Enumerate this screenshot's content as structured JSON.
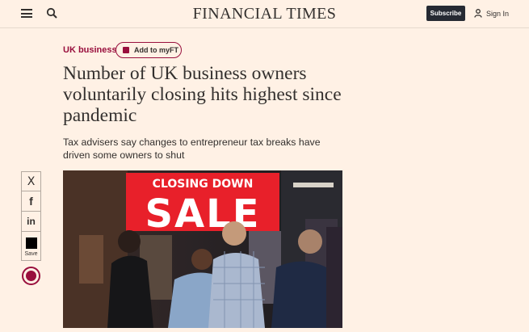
{
  "header": {
    "brand": "FINANCIAL TIMES",
    "subscribe_label": "Subscribe",
    "signin_label": "Sign In"
  },
  "article": {
    "topic": "UK business",
    "myft_label": "Add to myFT",
    "headline": "Number of UK business owners voluntarily closing hits highest since pandemic",
    "standfirst": "Tax advisers say changes to entrepreneur tax breaks have driven some owners to shut"
  },
  "share": {
    "save_label": "Save",
    "x_glyph": "X",
    "facebook_glyph": "f",
    "linkedin_glyph": "in"
  },
  "image": {
    "sign_top": "CLOSING DOWN",
    "sign_main": "SALE"
  },
  "colors": {
    "background": "#fff1e5",
    "claret": "#990f3d",
    "ink": "#33302e",
    "subscribe_bg": "#262a33",
    "sign_red": "#e8202a"
  }
}
